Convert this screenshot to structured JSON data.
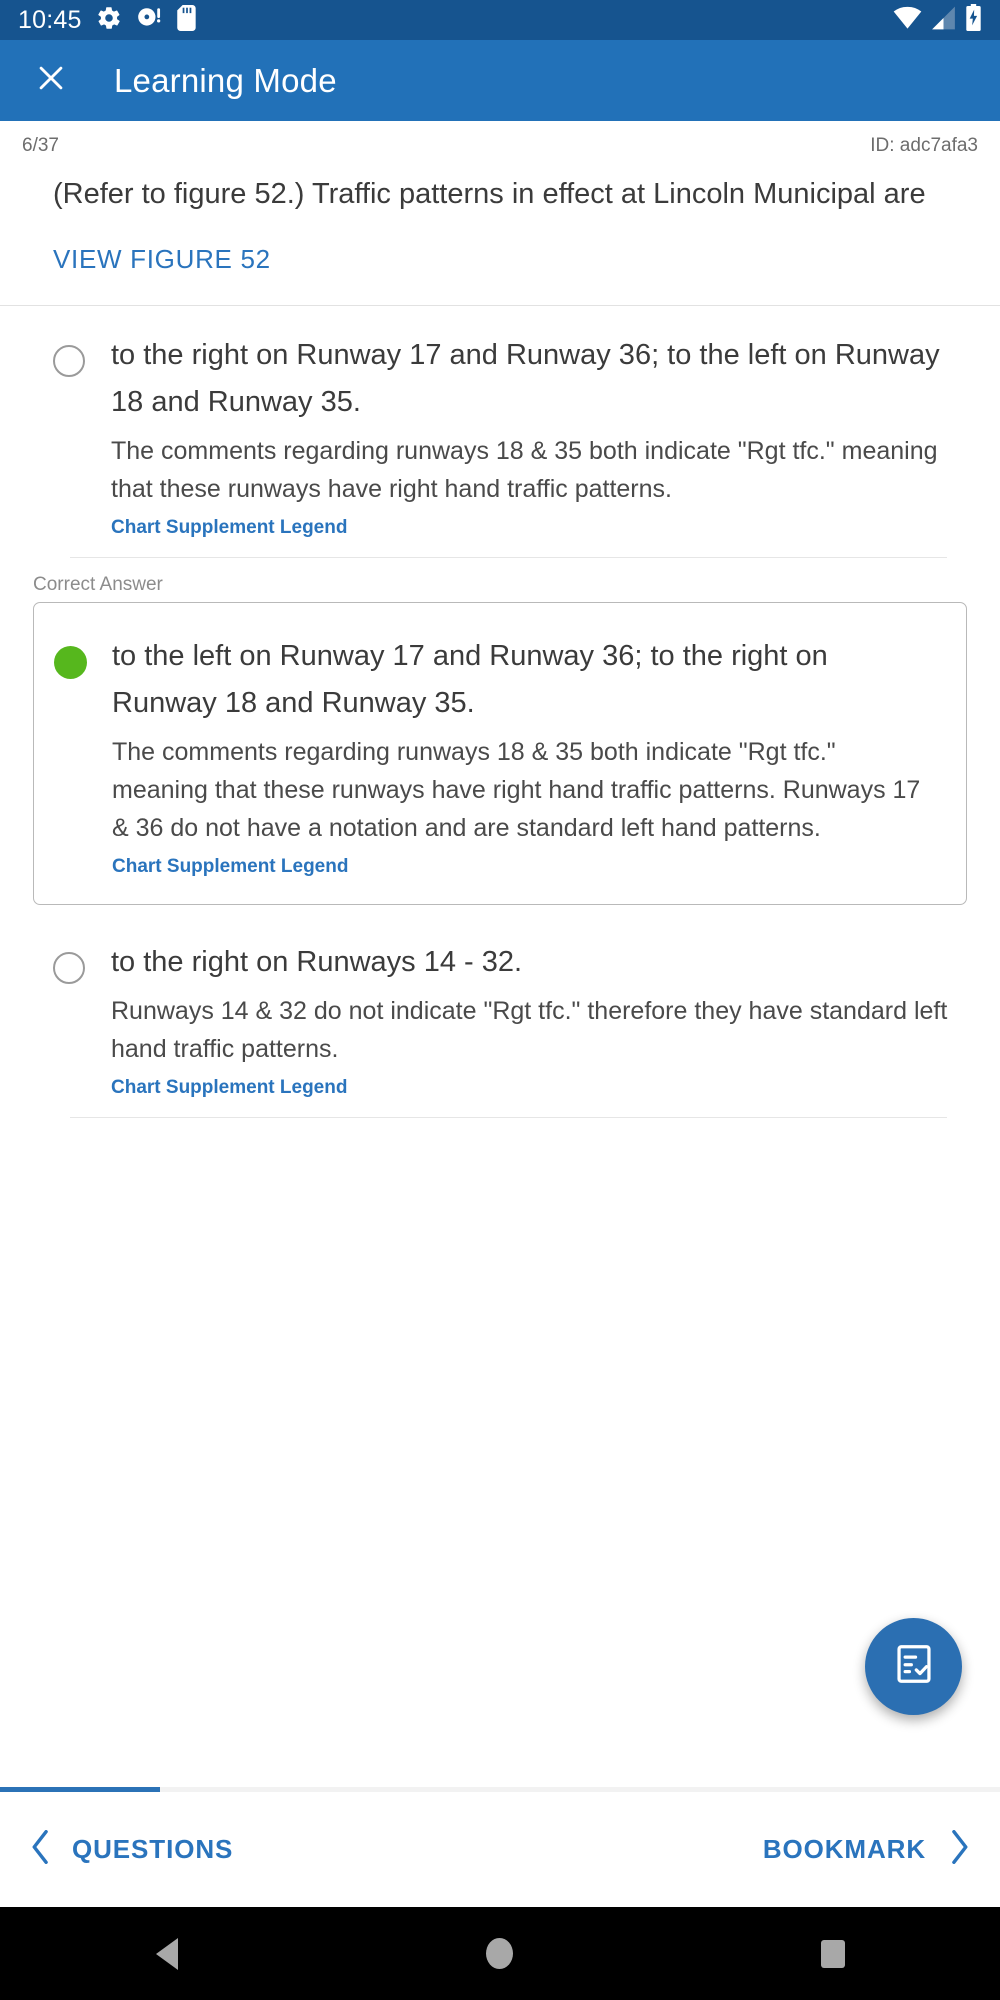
{
  "status_bar": {
    "time": "10:45",
    "left_icons": [
      "gear-icon",
      "disc-alert-icon",
      "sd-card-icon"
    ],
    "right_icons": [
      "wifi-icon",
      "cellular-signal-icon",
      "battery-charging-icon"
    ],
    "background_color": "#16548f"
  },
  "app_bar": {
    "close_icon": "close-icon",
    "title": "Learning Mode",
    "background_color": "#2271b8"
  },
  "question_meta": {
    "index": "6/37",
    "id": "ID: adc7afa3"
  },
  "question": {
    "text": "(Refer to figure 52.) Traffic patterns in effect at Lincoln Municipal are",
    "figure_link": "VIEW FIGURE 52"
  },
  "correct_answer_label": "Correct Answer",
  "options": [
    {
      "state": "unselected",
      "title": "to the right on Runway 17 and Runway 36; to the left on Runway 18 and Runway 35.",
      "explanation": "The comments regarding runways 18 & 35 both indicate \"Rgt tfc.\" meaning that these runways have right hand traffic patterns.",
      "reference_link": "Chart Supplement Legend"
    },
    {
      "state": "correct",
      "title": "to the left on Runway 17 and Runway 36; to the right on Runway 18 and Runway 35.",
      "explanation": "The comments regarding runways 18 & 35 both indicate \"Rgt tfc.\" meaning that these runways have right hand traffic patterns. Runways 17 & 36 do not have a notation and are standard left hand patterns.",
      "reference_link": "Chart Supplement Legend"
    },
    {
      "state": "unselected",
      "title": "to the right on Runways 14 - 32.",
      "explanation": "Runways 14 & 32 do not indicate \"Rgt tfc.\" therefore they have standard left hand traffic patterns.",
      "reference_link": "Chart Supplement Legend"
    }
  ],
  "fab": {
    "icon": "assignment-checklist-icon",
    "color": "#2b6fb2"
  },
  "progress": {
    "percent": 16,
    "fill_color": "#2b72b6"
  },
  "bottom_bar": {
    "prev_icon": "chevron-left-icon",
    "prev_label": "QUESTIONS",
    "next_label": "BOOKMARK",
    "next_icon": "chevron-right-icon",
    "link_color": "#2a74bd"
  },
  "android_nav": {
    "back": "back-triangle-icon",
    "home": "home-circle-icon",
    "recents": "recents-square-icon"
  },
  "colors": {
    "correct_green": "#56b71d",
    "radio_gray": "#9a9a9a",
    "text_primary": "#3b3b3b",
    "text_muted": "#6d6d6d"
  }
}
